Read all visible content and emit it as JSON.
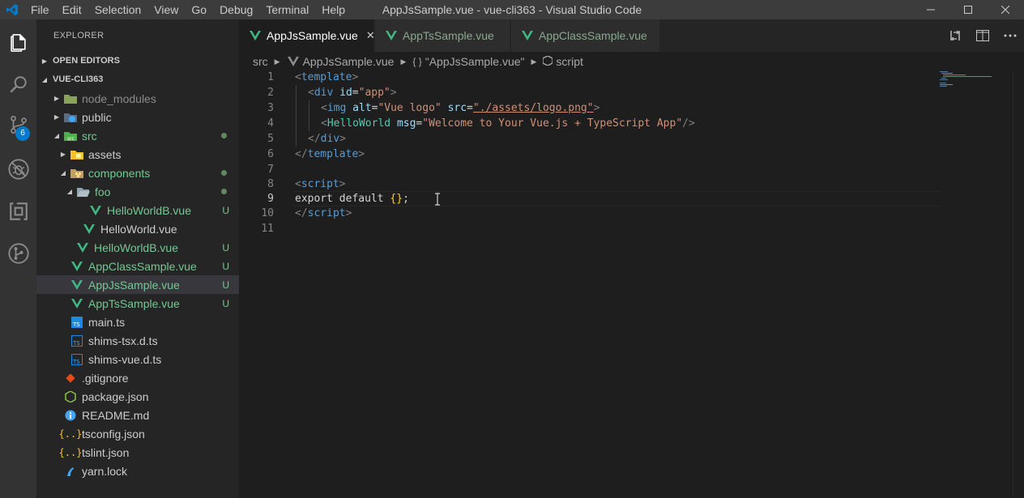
{
  "window": {
    "title": "AppJsSample.vue - vue-cli363 - Visual Studio Code",
    "menu": [
      "File",
      "Edit",
      "Selection",
      "View",
      "Go",
      "Debug",
      "Terminal",
      "Help"
    ]
  },
  "activity_bar": {
    "items": [
      "explorer-icon",
      "search-icon",
      "source-control-icon",
      "debug-icon",
      "extensions-icon",
      "git-history-icon"
    ],
    "scm_badge": "6"
  },
  "sidebar": {
    "title": "EXPLORER",
    "open_editors": "OPEN EDITORS",
    "project": "VUE-CLI363",
    "tree": [
      {
        "label": "node_modules",
        "kind": "folder",
        "color": "#8c8c8c"
      },
      {
        "label": "public",
        "kind": "folder",
        "color": "#cccccc"
      },
      {
        "label": "src",
        "kind": "folder",
        "color": "#73c991"
      },
      {
        "label": "assets",
        "kind": "folder",
        "color": "#cccccc"
      },
      {
        "label": "components",
        "kind": "folder",
        "color": "#73c991"
      },
      {
        "label": "foo",
        "kind": "folder",
        "color": "#73c991"
      },
      {
        "label": "HelloWorldB.vue",
        "kind": "vue",
        "color": "#73c991",
        "deco": "U"
      },
      {
        "label": "HelloWorld.vue",
        "kind": "vue",
        "color": "#cccccc"
      },
      {
        "label": "HelloWorldB.vue",
        "kind": "vue",
        "color": "#73c991",
        "deco": "U"
      },
      {
        "label": "AppClassSample.vue",
        "kind": "vue",
        "color": "#73c991",
        "deco": "U"
      },
      {
        "label": "AppJsSample.vue",
        "kind": "vue",
        "color": "#73c991",
        "deco": "U"
      },
      {
        "label": "AppTsSample.vue",
        "kind": "vue",
        "color": "#73c991",
        "deco": "U"
      },
      {
        "label": "main.ts",
        "kind": "ts",
        "color": "#cccccc"
      },
      {
        "label": "shims-tsx.d.ts",
        "kind": "ts",
        "color": "#cccccc"
      },
      {
        "label": "shims-vue.d.ts",
        "kind": "ts",
        "color": "#cccccc"
      },
      {
        "label": ".gitignore",
        "kind": "git",
        "color": "#cccccc"
      },
      {
        "label": "package.json",
        "kind": "node",
        "color": "#cccccc"
      },
      {
        "label": "README.md",
        "kind": "info",
        "color": "#cccccc"
      },
      {
        "label": "tsconfig.json",
        "kind": "json",
        "color": "#cccccc"
      },
      {
        "label": "tslint.json",
        "kind": "json",
        "color": "#cccccc"
      },
      {
        "label": "yarn.lock",
        "kind": "yarn",
        "color": "#cccccc"
      }
    ]
  },
  "tabs": [
    {
      "label": "AppJsSample.vue",
      "active": true
    },
    {
      "label": "AppTsSample.vue",
      "active": false
    },
    {
      "label": "AppClassSample.vue",
      "active": false
    }
  ],
  "breadcrumb": {
    "folder": "src",
    "file": "AppJsSample.vue",
    "symbol_icon": "{ }",
    "symbol": "\"AppJsSample.vue\"",
    "leaf": "script"
  },
  "editor": {
    "line_numbers": [
      "1",
      "2",
      "3",
      "4",
      "5",
      "6",
      "7",
      "8",
      "9",
      "10",
      "11"
    ],
    "current_line": "9",
    "code": {
      "l1": {
        "tag": "template"
      },
      "l2": {
        "tag": "div",
        "attr": "id",
        "val": "\"app\""
      },
      "l3": {
        "tag": "img",
        "attr1": "alt",
        "val1": "\"Vue logo\"",
        "attr2": "src",
        "val2": "\"./assets/logo.png\""
      },
      "l4": {
        "comp": "HelloWorld",
        "attr": "msg",
        "val": "\"Welcome to Your Vue.js + TypeScript App\""
      },
      "l5": {
        "tag": "div"
      },
      "l6": {
        "tag": "template"
      },
      "l8": {
        "tag": "script"
      },
      "l9": {
        "kw1": "export",
        "kw2": "default",
        "braces": "{}",
        "semi": ";"
      },
      "l10": {
        "tag": "script"
      }
    }
  },
  "colors": {
    "accent": "#007acc",
    "untracked": "#73c991",
    "vue": "#41b883"
  }
}
